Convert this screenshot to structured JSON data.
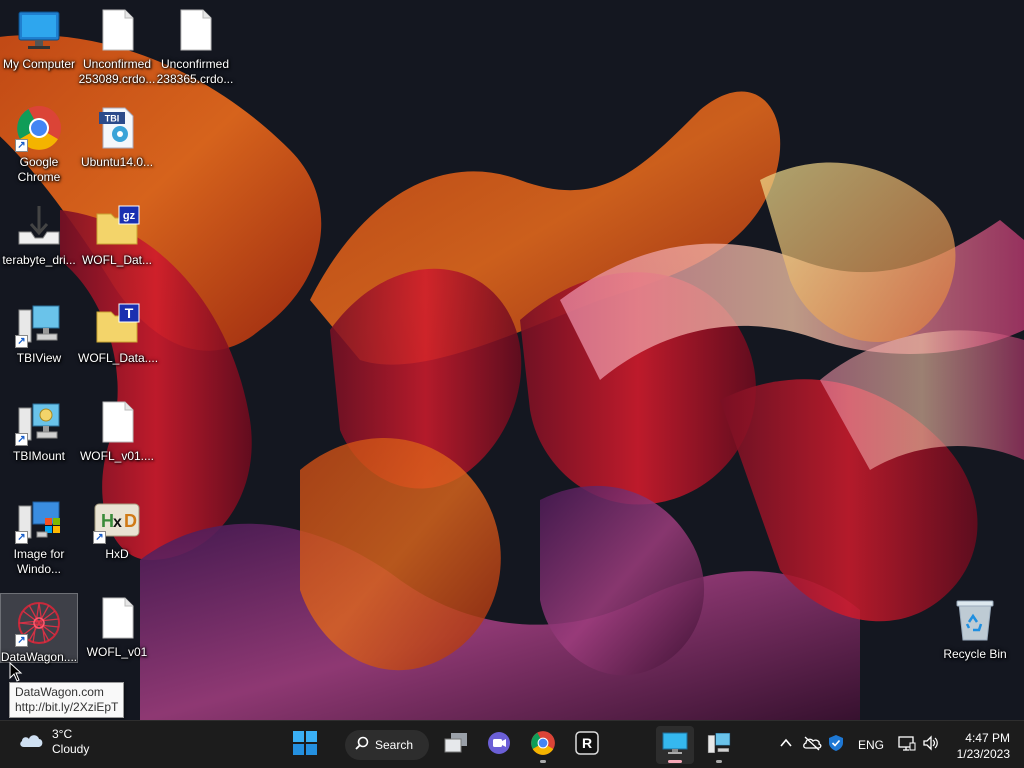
{
  "desktop": {
    "icons": [
      {
        "label": "My Computer",
        "icon": "computer-icon"
      },
      {
        "label": "Unconfirmed\n253089.crdo...",
        "icon": "file-icon"
      },
      {
        "label": "Unconfirmed\n238365.crdo...",
        "icon": "file-icon"
      },
      {
        "label": "Google\nChrome",
        "icon": "chrome-icon"
      },
      {
        "label": "Ubuntu14.0...",
        "icon": "tbi-file-icon",
        "badge": "TBI"
      },
      {
        "label": "terabyte_dri...",
        "icon": "download-tray-icon"
      },
      {
        "label": "WOFL_Dat...",
        "icon": "gz-archive-icon",
        "badge": "gz"
      },
      {
        "label": "TBIView",
        "icon": "tbiview-icon"
      },
      {
        "label": "WOFL_Data....",
        "icon": "text-archive-icon",
        "badge": "T"
      },
      {
        "label": "TBIMount",
        "icon": "tbimount-icon"
      },
      {
        "label": "WOFL_v01....",
        "icon": "file-icon"
      },
      {
        "label": "Image for\nWindo...",
        "icon": "image-for-windows-icon"
      },
      {
        "label": "HxD",
        "icon": "hxd-icon"
      },
      {
        "label": "DataWagon....",
        "icon": "datawagon-icon"
      },
      {
        "label": "WOFL_v01",
        "icon": "file-icon"
      },
      {
        "label": "Recycle Bin",
        "icon": "recycle-bin-icon"
      }
    ],
    "tooltip": {
      "line1": "DataWagon.com",
      "line2": "http://bit.ly/2XziEpT"
    }
  },
  "taskbar": {
    "weather": {
      "temp": "3°C",
      "condition": "Cloudy",
      "icon": "cloud-icon"
    },
    "search_label": "Search",
    "pinned": [
      "windows-start-icon",
      "search-icon",
      "task-view-icon",
      "chat-icon",
      "chrome-icon",
      "r-app-icon",
      "tbiview-icon",
      "tbimount-icon"
    ],
    "tray": {
      "language": "ENG"
    },
    "clock": {
      "time": "4:47 PM",
      "date": "1/23/2023"
    }
  },
  "colors": {
    "taskbar": "#1c1c1c",
    "accent": "#f7a8b8",
    "wallpaper_base": "#141720"
  }
}
